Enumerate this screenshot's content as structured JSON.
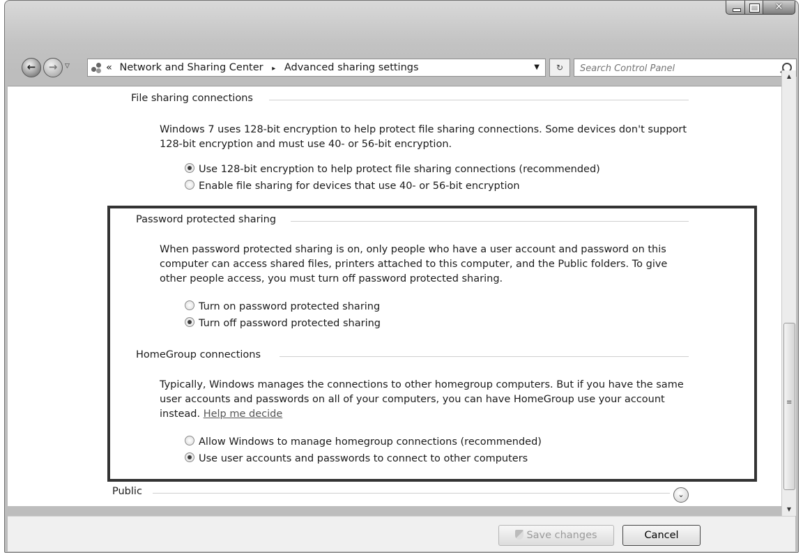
{
  "address": {
    "breadcrumb_prefix": "«",
    "crumb1": "Network and Sharing Center",
    "crumb2": "Advanced sharing settings",
    "separator": "▸"
  },
  "search": {
    "placeholder": "Search Control Panel"
  },
  "sections": {
    "file_sharing": {
      "title": "File sharing connections",
      "description": "Windows 7 uses 128-bit encryption to help protect file sharing connections. Some devices don't support 128-bit encryption and must use 40- or 56-bit encryption.",
      "options": [
        {
          "label": "Use 128-bit encryption to help protect file sharing connections (recommended)",
          "selected": true
        },
        {
          "label": "Enable file sharing for devices that use 40- or 56-bit encryption",
          "selected": false
        }
      ]
    },
    "password": {
      "title": "Password protected sharing",
      "description": "When password protected sharing is on, only people who have a user account and password on this computer can access shared files, printers attached to this computer, and the Public folders. To give other people access, you must turn off password protected sharing.",
      "options": [
        {
          "label": "Turn on password protected sharing",
          "selected": false
        },
        {
          "label": "Turn off password protected sharing",
          "selected": true
        }
      ]
    },
    "homegroup": {
      "title": "HomeGroup connections",
      "description": "Typically, Windows manages the connections to other homegroup computers. But if you have the same user accounts and passwords on all of your computers, you can have HomeGroup use your account instead.",
      "help_link": "Help me decide",
      "options": [
        {
          "label": "Allow Windows to manage homegroup connections (recommended)",
          "selected": false
        },
        {
          "label": "Use user accounts and passwords to connect to other computers",
          "selected": true
        }
      ]
    },
    "public": {
      "title": "Public"
    }
  },
  "footer": {
    "save_label": "Save changes",
    "cancel_label": "Cancel"
  }
}
